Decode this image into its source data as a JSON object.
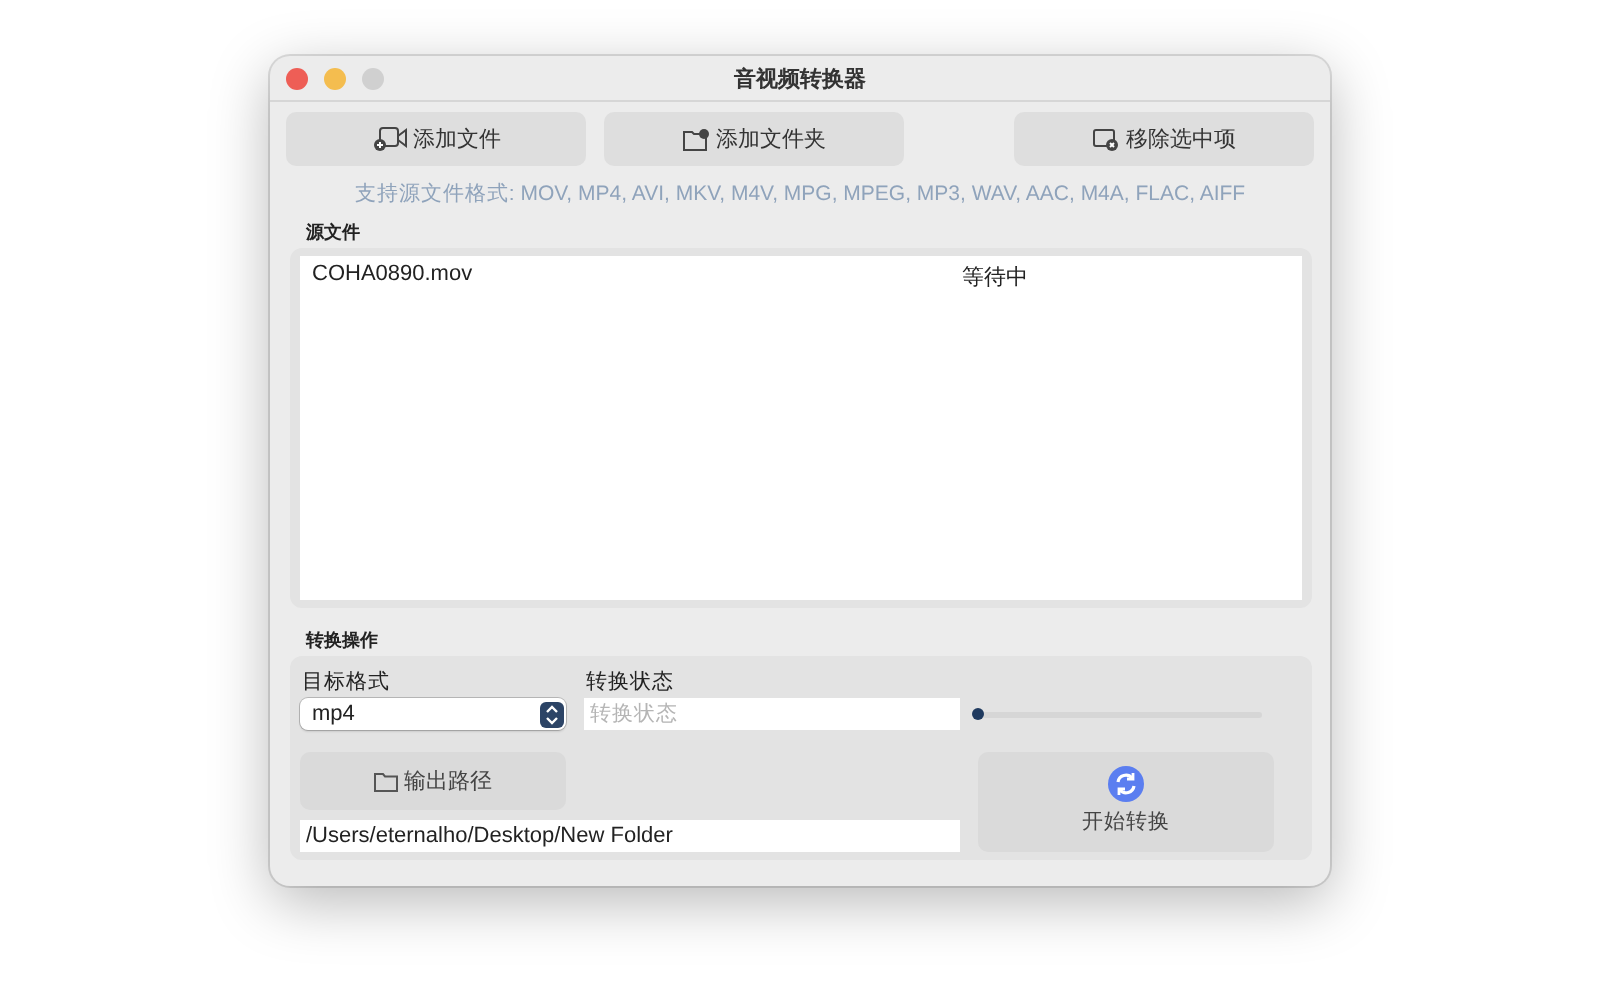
{
  "window": {
    "title": "音视频转换器"
  },
  "toolbar": [
    {
      "label": "添加文件",
      "kind": "add-file"
    },
    {
      "label": "添加文件夹",
      "kind": "add-folder"
    },
    {
      "label": "移除选中项",
      "kind": "remove"
    }
  ],
  "formats_hint": "支持源文件格式: MOV, MP4, AVI, MKV, M4V, MPG, MPEG, MP3, WAV, AAC, M4A, FLAC, AIFF",
  "source": {
    "title": "源文件",
    "files": [
      {
        "name": "COHA0890.mov",
        "status": "等待中"
      }
    ]
  },
  "conversion": {
    "title": "转换操作",
    "format_label": "目标格式",
    "format_value": "mp4",
    "status_label": "转换状态",
    "status_placeholder": "转换状态",
    "progress": {
      "level": 0
    },
    "output_button": "输出路径",
    "output_path": "/Users/eternalho/Desktop/New Folder",
    "start_button": "开始转换"
  }
}
